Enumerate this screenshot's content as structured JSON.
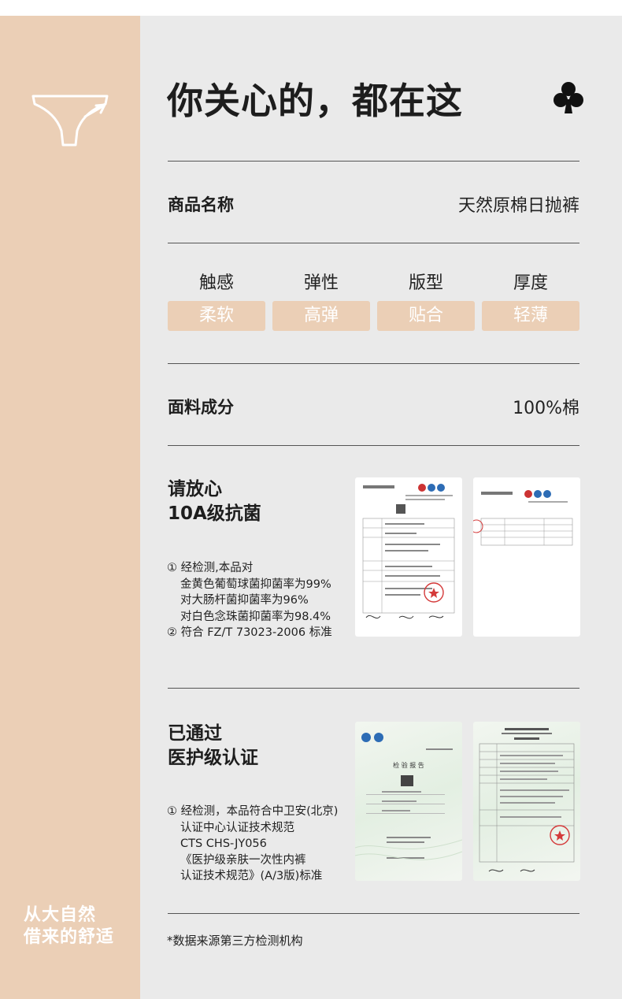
{
  "sidebar": {
    "slogan_line1": "从大自然",
    "slogan_line2": "借来的舒适"
  },
  "header": {
    "title": "你关心的，都在这"
  },
  "product": {
    "name_label": "商品名称",
    "name_value": "天然原棉日抛裤"
  },
  "attributes": [
    {
      "name": "触感",
      "value": "柔软"
    },
    {
      "name": "弹性",
      "value": "高弹"
    },
    {
      "name": "版型",
      "value": "贴合"
    },
    {
      "name": "厚度",
      "value": "轻薄"
    }
  ],
  "fabric": {
    "label": "面料成分",
    "value": "100%棉"
  },
  "antibacterial": {
    "title_line1": "请放心",
    "title_line2": "10A级抗菌",
    "notes": [
      "① 经检测,本品对",
      "金黄色葡萄球菌抑菌率为99%",
      "对大肠杆菌抑菌率为96%",
      "对白色念珠菌抑菌率为98.4%",
      "② 符合 FZ/T 73023-2006 标准"
    ]
  },
  "certification": {
    "title_line1": "已通过",
    "title_line2": "医护级认证",
    "notes": [
      "① 经检测，本品符合中卫安(北京)",
      "认证中心认证技术规范",
      "CTS CHS-JY056",
      "《医护级亲肤一次性内裤",
      "认证技术规范》(A/3版)标准"
    ],
    "report_heading": "检 验 报 告"
  },
  "footnote": "*数据来源第三方检测机构",
  "colors": {
    "accent": "#ebcfb6",
    "panel": "#eaeaea",
    "text": "#1d1d1d"
  },
  "icons": {
    "sidebar_icon": "briefs-icon",
    "header_icon": "club-icon"
  }
}
